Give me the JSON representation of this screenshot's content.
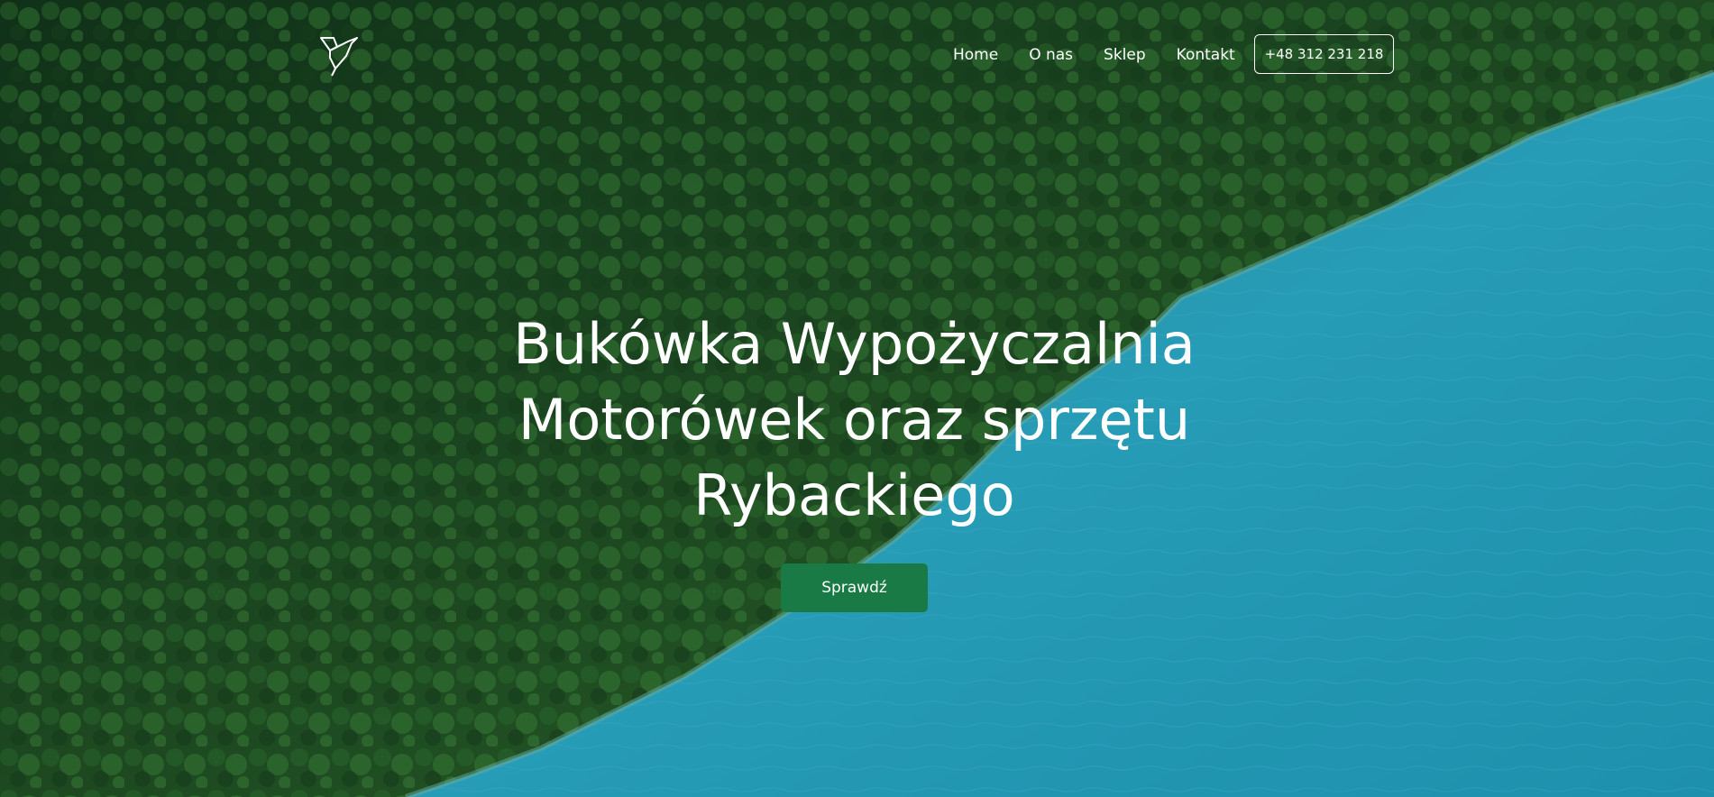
{
  "brand": {
    "logo_icon": "bird-icon"
  },
  "nav": {
    "items": [
      {
        "label": "Home"
      },
      {
        "label": "O nas"
      },
      {
        "label": "Sklep"
      },
      {
        "label": "Kontakt"
      }
    ],
    "phone": "+48 312 231 218"
  },
  "hero": {
    "title_lines": [
      "Bukówka Wypożyczalnia",
      "Motorówek oraz sprzętu",
      "Rybackiego"
    ],
    "cta_label": "Sprawdź"
  },
  "colors": {
    "forest": "#1f4d23",
    "water": "#2aa6c2",
    "cta": "#1a7a45",
    "text": "#ffffff"
  }
}
